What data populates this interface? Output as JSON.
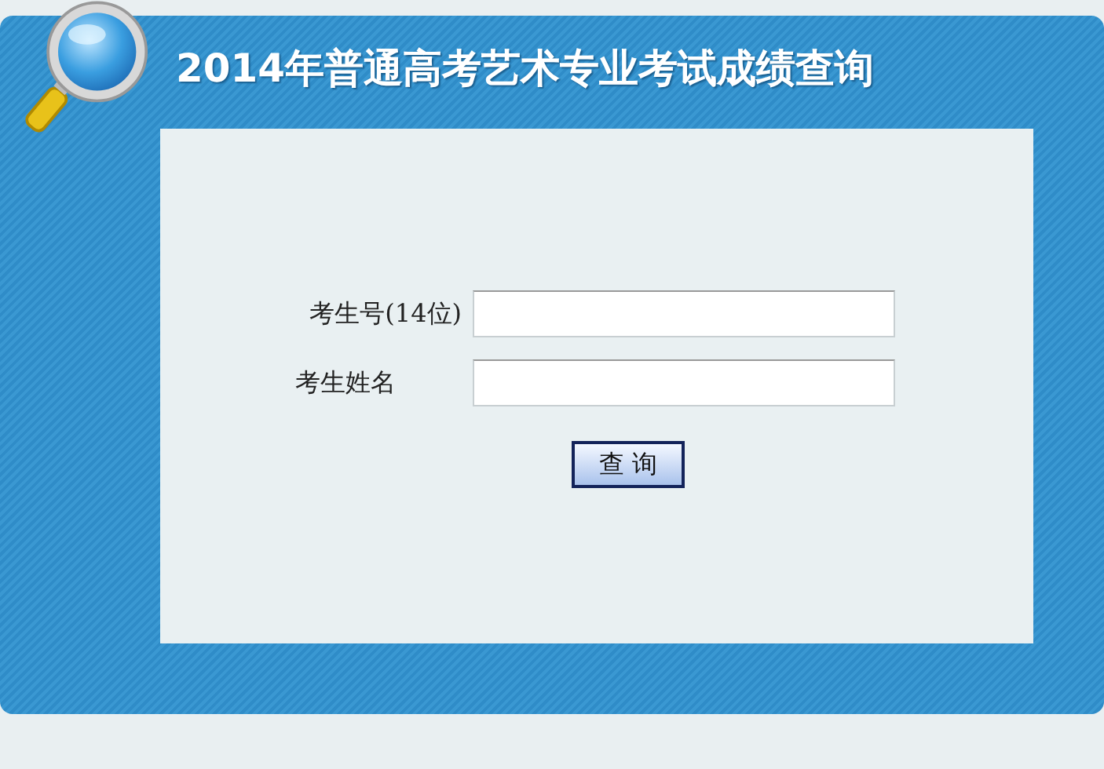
{
  "header": {
    "title": "2014年普通高考艺术专业考试成绩查询"
  },
  "form": {
    "fields": [
      {
        "label": "考生号(14位)"
      },
      {
        "label": "考生姓名"
      }
    ],
    "submit": "查 询"
  }
}
